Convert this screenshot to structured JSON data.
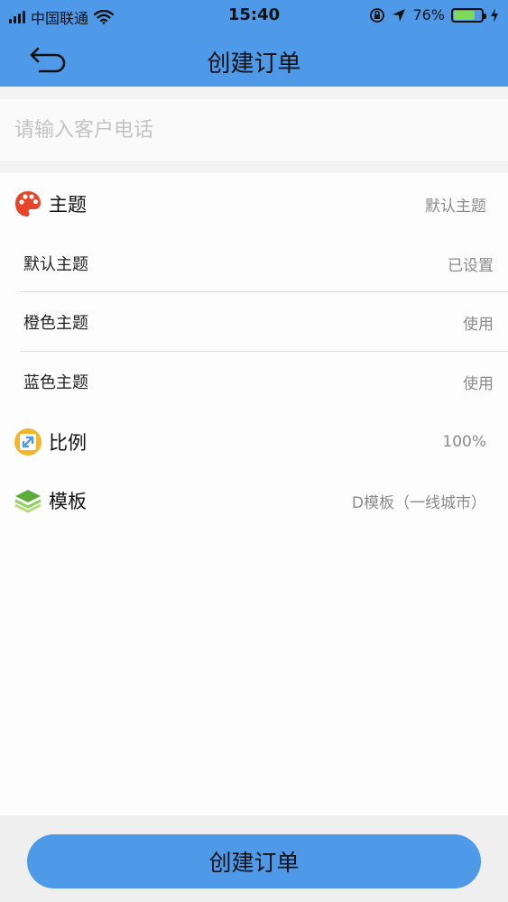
{
  "status_bar": {
    "carrier": "中国联通",
    "time": "15:40",
    "battery_percent": "76%",
    "battery_level": 0.76
  },
  "header": {
    "title": "创建订单",
    "back_icon": "back-arrow-icon",
    "background": "#4f9ae8"
  },
  "phone": {
    "placeholder": "请输入客户电话",
    "value": ""
  },
  "settings": {
    "theme": {
      "label": "主题",
      "value": "默认主题",
      "icon": "palette-icon"
    },
    "theme_options": [
      {
        "label": "默认主题",
        "value": "已设置"
      },
      {
        "label": "橙色主题",
        "value": "使用"
      },
      {
        "label": "蓝色主题",
        "value": "使用"
      }
    ],
    "scale": {
      "label": "比例",
      "value": "100%",
      "icon": "resize-icon"
    },
    "template": {
      "label": "模板",
      "value": "D模板（一线城市）",
      "icon": "layers-icon"
    }
  },
  "submit": {
    "label": "创建订单"
  }
}
